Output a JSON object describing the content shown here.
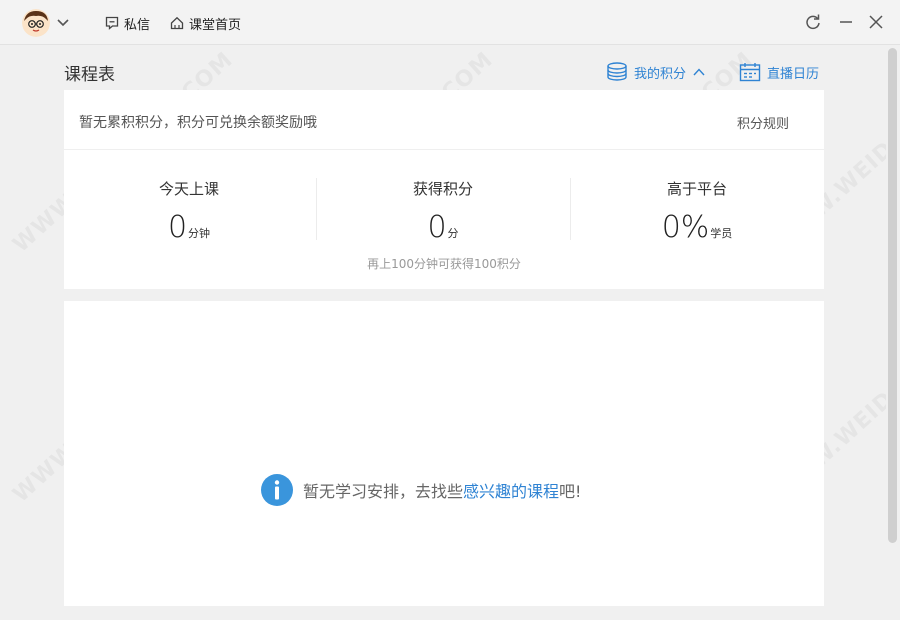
{
  "titlebar": {
    "messages_label": "私信",
    "home_label": "课堂首页"
  },
  "header": {
    "title": "课程表",
    "points_link": "我的积分",
    "calendar_link": "直播日历"
  },
  "points": {
    "message": "暂无累积积分，积分可兑换余额奖励哦",
    "rules_link": "积分规则",
    "stats": [
      {
        "label": "今天上课",
        "value": "0",
        "unit": "分钟"
      },
      {
        "label": "获得积分",
        "value": "0",
        "unit": "分"
      },
      {
        "label": "高于平台",
        "value": "0%",
        "unit": "学员"
      }
    ],
    "hint": "再上100分钟可获得100积分"
  },
  "schedule": {
    "empty_prefix": "暂无学习安排，去找些",
    "empty_link": "感兴趣的课程",
    "empty_suffix": "吧!"
  },
  "watermark": "WWW.WEIDOWN.COM",
  "colors": {
    "accent": "#2f83d3",
    "info_icon": "#3a95dc"
  }
}
